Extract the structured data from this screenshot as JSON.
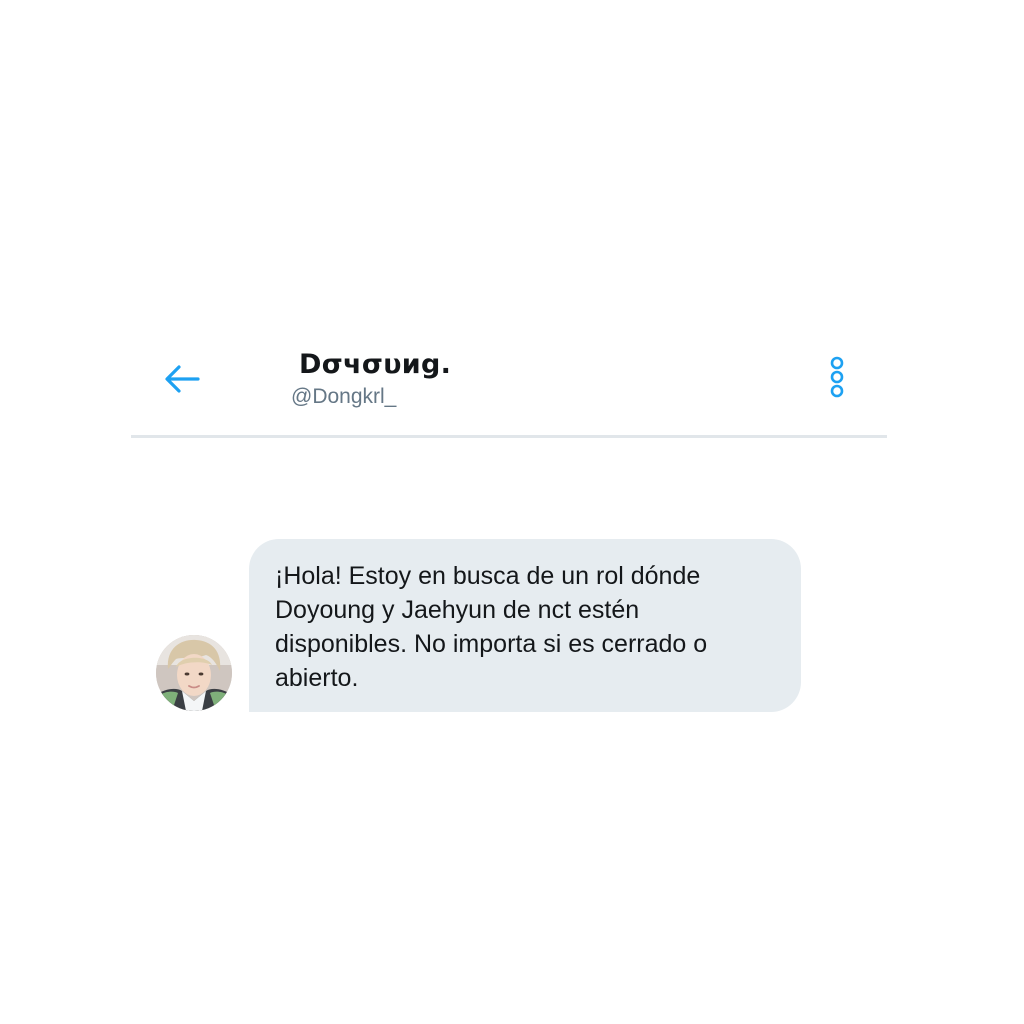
{
  "conversation": {
    "header": {
      "display_name": "Dσчσυиg.",
      "handle": "@Dongkrl_",
      "back_icon": "arrow-left-icon",
      "more_icon": "more-vertical-icon",
      "accent_color": "#1da1f2"
    },
    "messages": [
      {
        "direction": "received",
        "text": "¡Hola! Estoy en busca de un rol dónde Doyoung y Jaehyun de nct estén disponibles. No importa si es cerrado o abierto.",
        "bubble_color": "#e6ecf0"
      }
    ]
  }
}
